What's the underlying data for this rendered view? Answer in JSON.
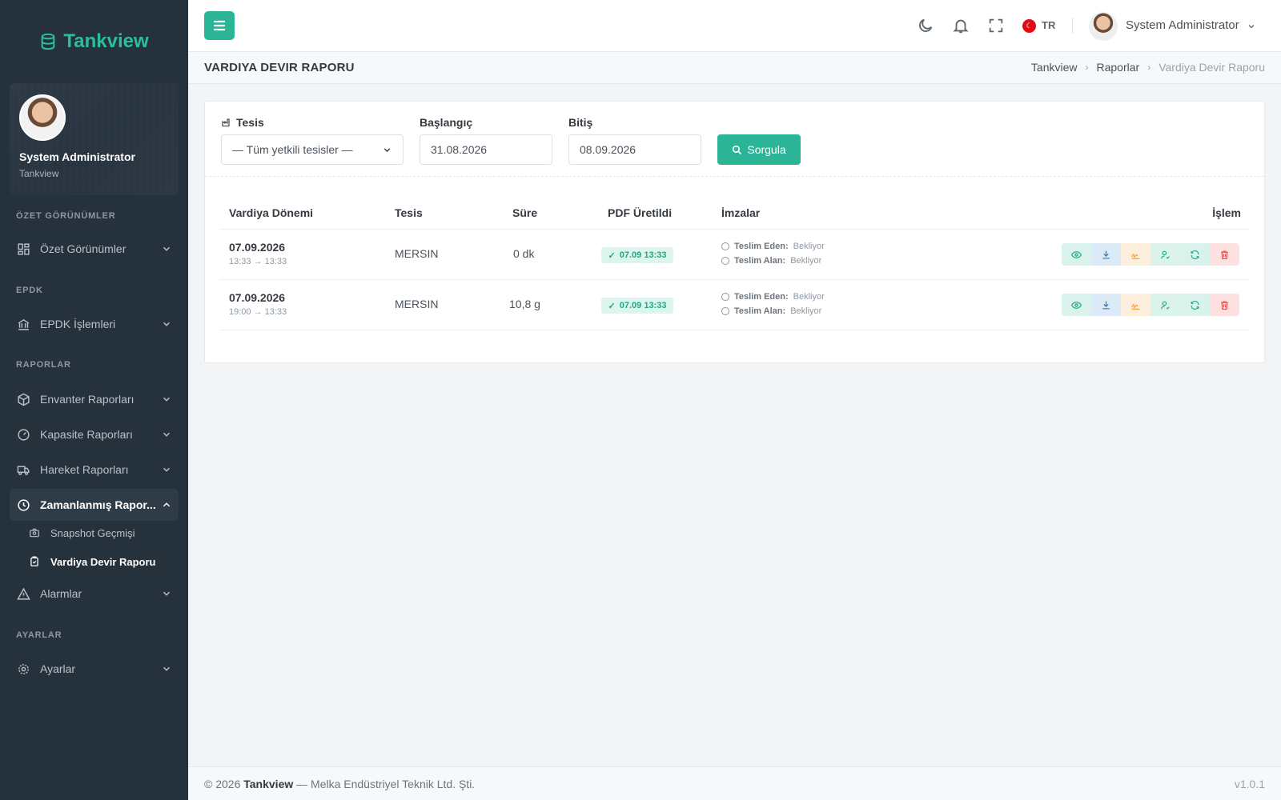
{
  "brand": {
    "name": "Tankview",
    "accent": "#2bb596"
  },
  "sidebar": {
    "user": {
      "name": "System Administrator",
      "org": "Tankview"
    },
    "sections": {
      "ozet": "ÖZET GÖRÜNÜMLER",
      "epdk": "EPDK",
      "raporlar": "RAPORLAR",
      "ayarlar": "AYARLAR"
    },
    "items": {
      "ozet": "Özet Görünümler",
      "epdk": "EPDK İşlemleri",
      "envanter": "Envanter Raporları",
      "kapasite": "Kapasite Raporları",
      "hareket": "Hareket Raporları",
      "zamanlanmis": "Zamanlanmış Rapor...",
      "snapshot": "Snapshot Geçmişi",
      "vardiya": "Vardiya Devir Raporu",
      "alarmlar": "Alarmlar",
      "ayarlar": "Ayarlar"
    }
  },
  "topbar": {
    "lang": "TR",
    "user": "System Administrator"
  },
  "page": {
    "title": "VARDIYA DEVIR RAPORU",
    "breadcrumb": [
      "Tankview",
      "Raporlar",
      "Vardiya Devir Raporu"
    ]
  },
  "filters": {
    "tesis_label": "Tesis",
    "tesis_value": "— Tüm yetkili tesisler —",
    "baslangic_label": "Başlangıç",
    "baslangic_value": "31.08.2026",
    "bitis_label": "Bitiş",
    "bitis_value": "08.09.2026",
    "query_button": "Sorgula"
  },
  "table": {
    "headers": [
      "Vardiya Dönemi",
      "Tesis",
      "Süre",
      "PDF Üretildi",
      "İmzalar",
      "İşlem"
    ],
    "rows": [
      {
        "date": "07.09.2026",
        "range": "13:33 → 13:33",
        "tesis": "MERSIN",
        "sure": "0 dk",
        "pdf": "07.09 13:33",
        "teslim_eden_label": "Teslim Eden:",
        "teslim_eden_value": "Bekliyor",
        "teslim_alan_label": "Teslim Alan:",
        "teslim_alan_value": "Bekliyor"
      },
      {
        "date": "07.09.2026",
        "range": "19:00 → 13:33",
        "tesis": "MERSIN",
        "sure": "10,8 g",
        "pdf": "07.09 13:33",
        "teslim_eden_label": "Teslim Eden:",
        "teslim_eden_value": "Bekliyor",
        "teslim_alan_label": "Teslim Alan:",
        "teslim_alan_value": "Bekliyor"
      }
    ],
    "action_icons": [
      "eye-icon",
      "download-icon",
      "signature-icon",
      "user-check-icon",
      "refresh-icon",
      "trash-icon"
    ]
  },
  "footer": {
    "copyright_prefix": "© 2026",
    "company_name": "Tankview",
    "copyright_suffix": "— Melka Endüstriyel Teknik Ltd. Şti.",
    "version": "v1.0.1"
  }
}
